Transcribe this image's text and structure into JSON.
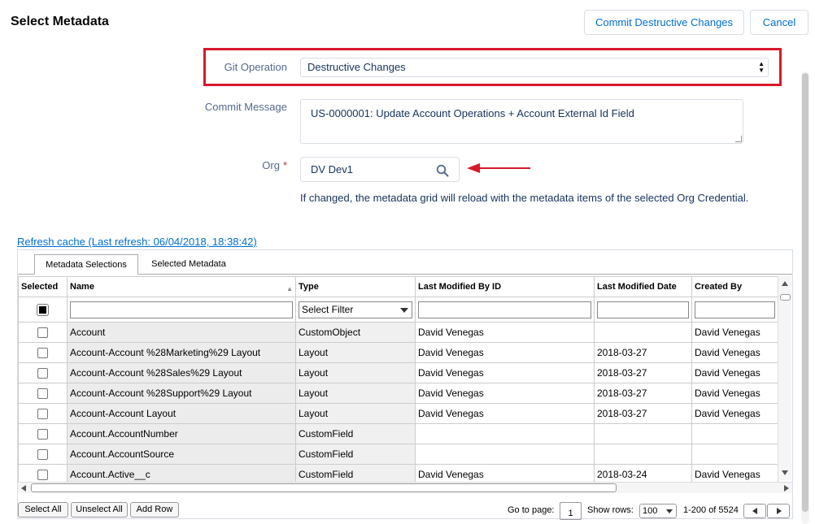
{
  "header": {
    "title": "Select Metadata",
    "commit_button": "Commit Destructive Changes",
    "cancel_button": "Cancel"
  },
  "form": {
    "git_operation_label": "Git Operation",
    "git_operation_value": "Destructive Changes",
    "commit_message_label": "Commit Message",
    "commit_message_value": "US-0000001: Update Account Operations + Account External Id Field",
    "org_label": "Org",
    "org_required": "*",
    "org_value": "DV Dev1",
    "org_hint": "If changed, the metadata grid will reload with the metadata items of the selected Org Credential."
  },
  "refresh_link": "Refresh cache (Last refresh: 06/04/2018, 18:38:42)",
  "tabs": [
    "Metadata Selections",
    "Selected Metadata"
  ],
  "grid": {
    "columns": [
      "Selected",
      "Name",
      "Type",
      "Last Modified By ID",
      "Last Modified Date",
      "Created By"
    ],
    "type_filter_placeholder": "Select Filter",
    "rows": [
      {
        "name": "Account",
        "type": "CustomObject",
        "modified_by": "David Venegas",
        "modified_date": "",
        "created_by": "David Venegas"
      },
      {
        "name": "Account-Account %28Marketing%29 Layout",
        "type": "Layout",
        "modified_by": "David Venegas",
        "modified_date": "2018-03-27",
        "created_by": "David Venegas"
      },
      {
        "name": "Account-Account %28Sales%29 Layout",
        "type": "Layout",
        "modified_by": "David Venegas",
        "modified_date": "2018-03-27",
        "created_by": "David Venegas"
      },
      {
        "name": "Account-Account %28Support%29 Layout",
        "type": "Layout",
        "modified_by": "David Venegas",
        "modified_date": "2018-03-27",
        "created_by": "David Venegas"
      },
      {
        "name": "Account-Account Layout",
        "type": "Layout",
        "modified_by": "David Venegas",
        "modified_date": "2018-03-27",
        "created_by": "David Venegas"
      },
      {
        "name": "Account.AccountNumber",
        "type": "CustomField",
        "modified_by": "",
        "modified_date": "",
        "created_by": ""
      },
      {
        "name": "Account.AccountSource",
        "type": "CustomField",
        "modified_by": "",
        "modified_date": "",
        "created_by": ""
      },
      {
        "name": "Account.Active__c",
        "type": "CustomField",
        "modified_by": "David Venegas",
        "modified_date": "2018-03-24",
        "created_by": "David Venegas"
      }
    ]
  },
  "footer": {
    "select_all": "Select All",
    "unselect_all": "Unselect All",
    "add_row": "Add Row",
    "goto_label": "Go to page:",
    "goto_value": "1",
    "rows_label": "Show rows:",
    "rows_value": "100",
    "range": "1-200 of 5524"
  },
  "colors": {
    "accent": "#0070d2",
    "highlight": "#d7182a"
  }
}
